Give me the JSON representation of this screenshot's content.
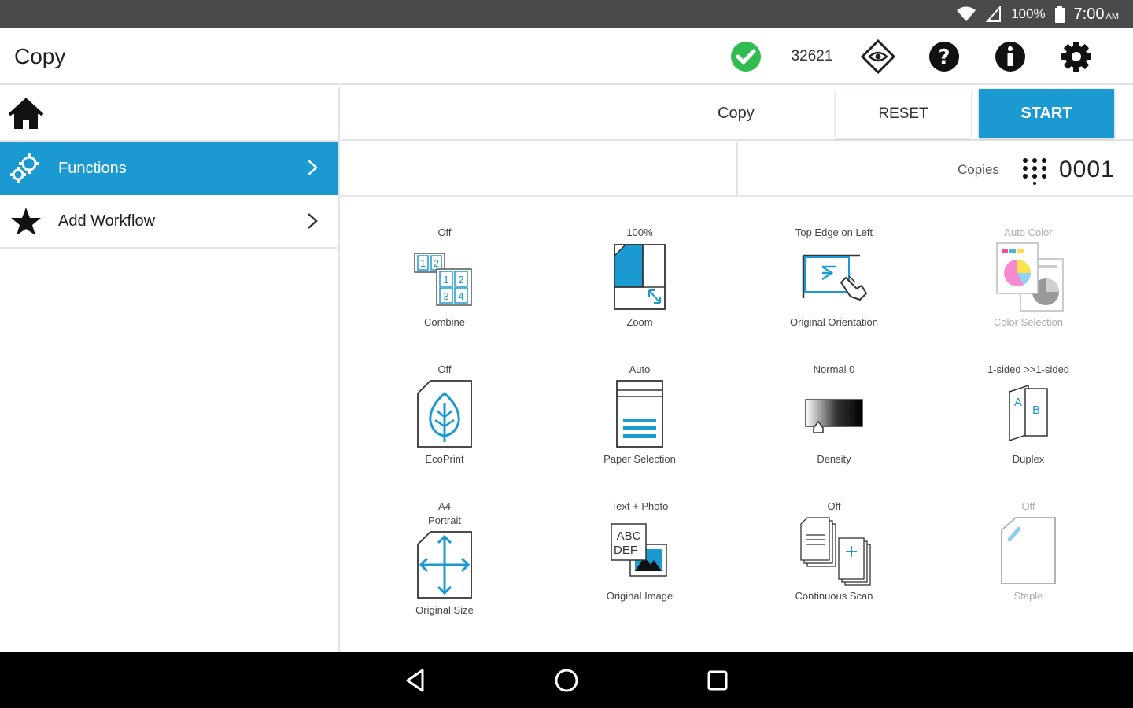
{
  "status_bar": {
    "battery": "100%",
    "time": "7:00",
    "ampm": "AM"
  },
  "app_bar": {
    "title": "Copy",
    "counter": "32621"
  },
  "sidebar": {
    "items": [
      {
        "label": "Functions",
        "icon": "gears-icon",
        "active": true
      },
      {
        "label": "Add Workflow",
        "icon": "star-icon",
        "active": false
      }
    ]
  },
  "toolbar": {
    "mode_label": "Copy",
    "reset_label": "RESET",
    "start_label": "START"
  },
  "copies": {
    "label": "Copies",
    "value": "0001"
  },
  "functions": [
    {
      "name": "Combine",
      "value": "Off",
      "icon": "combine-icon",
      "enabled": true
    },
    {
      "name": "Zoom",
      "value": "100%",
      "icon": "zoom-icon",
      "enabled": true
    },
    {
      "name": "Original Orientation",
      "value": "Top Edge on Left",
      "icon": "orientation-icon",
      "enabled": true
    },
    {
      "name": "Color Selection",
      "value": "Auto Color",
      "icon": "color-selection-icon",
      "enabled": false
    },
    {
      "name": "EcoPrint",
      "value": "Off",
      "icon": "ecoprint-icon",
      "enabled": true
    },
    {
      "name": "Paper Selection",
      "value": "Auto",
      "icon": "paper-selection-icon",
      "enabled": true
    },
    {
      "name": "Density",
      "value": "Normal 0",
      "icon": "density-icon",
      "enabled": true
    },
    {
      "name": "Duplex",
      "value": "1-sided >>1-sided",
      "icon": "duplex-icon",
      "enabled": true
    },
    {
      "name": "Original Size",
      "value": "A4",
      "value2": "Portrait",
      "icon": "original-size-icon",
      "enabled": true
    },
    {
      "name": "Original Image",
      "value": "Text + Photo",
      "icon": "original-image-icon",
      "enabled": true
    },
    {
      "name": "Continuous Scan",
      "value": "Off",
      "icon": "continuous-scan-icon",
      "enabled": true
    },
    {
      "name": "Staple",
      "value": "Off",
      "icon": "staple-icon",
      "enabled": false
    }
  ],
  "icon_text": {
    "combine_cells": [
      "1",
      "2",
      "1",
      "2",
      "3",
      "4"
    ],
    "duplex_a": "A",
    "duplex_b": "B",
    "image_line1": "ABC",
    "image_line2": "DEF"
  },
  "colors": {
    "accent": "#1a9ad0",
    "status_bar": "#4a4a4a",
    "nav_bar": "#000000",
    "ok_green": "#2ebd4e"
  }
}
